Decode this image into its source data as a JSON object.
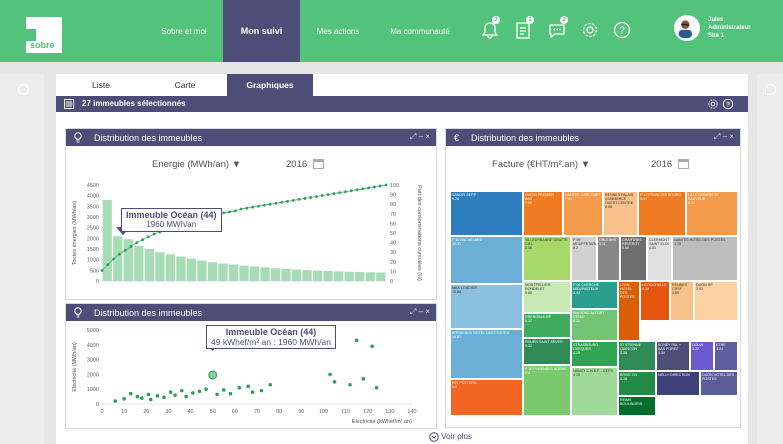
{
  "brand": {
    "logo_text": "sobre",
    "green": "#53c27a",
    "purple": "#4e4d78"
  },
  "nav": [
    {
      "label": "Sobre et moi",
      "active": false
    },
    {
      "label": "Mon suivi",
      "active": true
    },
    {
      "label": "Mes actions",
      "active": false
    },
    {
      "label": "Ma communauté",
      "active": false
    }
  ],
  "notifications": {
    "alerts": "3",
    "reports": "1",
    "messages": "2"
  },
  "user": {
    "name": "Jules",
    "role": "Administrateur",
    "site": "Site 1"
  },
  "tabs": [
    "Liste",
    "Carte",
    "Graphiques"
  ],
  "selection": {
    "label": "27 immeubles  sélectionnés"
  },
  "card1": {
    "title": "Distribution des immeubles",
    "filter": "Energie (MWh/an)",
    "year": "2016"
  },
  "card2": {
    "title": "Distribution des immeubles",
    "filter": "Facture (€HT/m².an)",
    "year": "2016",
    "currency_icon": "€"
  },
  "card3": {
    "title": "Distribution des immeubles"
  },
  "voir_plus": "Voir plus",
  "chart_data": [
    {
      "type": "bar",
      "ylabel": "Toutes énergies (MWh/an)",
      "y2label": "Part des consommations cumulées (%)",
      "ylim": [
        0,
        4500
      ],
      "y2lim": [
        0,
        100
      ],
      "yticks": [
        0,
        500,
        1000,
        1500,
        2000,
        2500,
        3000,
        3500,
        4000,
        4500
      ],
      "y2ticks": [
        0,
        10,
        20,
        30,
        40,
        50,
        60,
        70,
        80,
        90,
        100
      ],
      "values": [
        3800,
        2100,
        1960,
        1650,
        1500,
        1350,
        1250,
        1150,
        1050,
        960,
        880,
        820,
        770,
        720,
        680,
        640,
        600,
        570,
        540,
        510,
        490,
        470,
        450,
        430,
        420,
        410,
        400
      ],
      "cumulative": [
        11,
        17,
        23,
        28,
        32,
        36,
        40,
        43,
        46,
        49,
        51,
        54,
        56,
        58,
        60,
        62,
        64,
        65,
        67,
        68,
        70,
        71,
        72,
        73,
        75,
        76,
        77,
        78,
        79,
        80,
        81,
        82,
        83,
        84,
        85,
        86,
        87,
        88,
        89,
        90,
        91,
        92,
        93,
        94,
        95,
        96,
        97,
        98,
        99,
        100
      ],
      "tooltip": {
        "title": "Immeuble  Océan (44)",
        "value": "1960 MWh/an"
      }
    },
    {
      "type": "treemap",
      "cells": [
        {
          "label": "SANOFI SEPP",
          "value": "9.26",
          "color": "#2f7ec0"
        },
        {
          "label": "OUDIN PREMIER BAS",
          "value": "7.60",
          "color": "#ef7b22"
        },
        {
          "label": "NANTES CARCOUET",
          "value": "7.31",
          "color": "#f39a4b"
        },
        {
          "label": "RENNES PALAIS COMMERCE OUEST-CENTRE",
          "value": "6.08",
          "color": "#f8c08a"
        },
        {
          "label": "P 12 FRANCOIS BOURG",
          "value": "5.94",
          "color": "#ef7b22"
        },
        {
          "label": "LILLE DEMIRIS ST SAUVEUR",
          "value": "5.24",
          "color": "#f39a4b"
        },
        {
          "label": "P 16 BACHELARD",
          "value": "10.31",
          "color": "#6baed6"
        },
        {
          "label": "VILLEURBANNE GRATTE CIEL",
          "value": "5.56",
          "color": "#a6d96a"
        },
        {
          "label": "P 09 MOUFFETARD",
          "value": "5.2",
          "color": "#d0d0d0"
        },
        {
          "label": "ORLEANS",
          "value": "5.11",
          "color": "#888888"
        },
        {
          "label": "CHARTRES REVEROY",
          "value": "5.00",
          "color": "#6f6f6f"
        },
        {
          "label": "CLERMONT SAINT ELOI",
          "value": "4.83",
          "color": "#e0e0e0"
        },
        {
          "label": "NANTES HOTEL DES POSTES",
          "value": "4.78",
          "color": "#bdbdbd"
        },
        {
          "label": "MAX LOUDIER",
          "value": "10.88",
          "color": "#8cc0e0"
        },
        {
          "label": "MONTPELLIER RONDELET",
          "value": "5.88",
          "color": "#c7e9b4"
        },
        {
          "label": "P 06 CHERCHE MIDI/PASTEUR",
          "value": "4.44",
          "color": "#2a9d8f"
        },
        {
          "label": "LYON HOTEL DES POSTES",
          "value": "",
          "color": "#d95f02"
        },
        {
          "label": "LA ROCHELLE",
          "value": "4.05",
          "color": "#e6550d"
        },
        {
          "label": "RENNES CRSF",
          "value": "3.85",
          "color": "#f8c08a"
        },
        {
          "label": "DIJON RP",
          "value": "3.92",
          "color": "#fdd0a2"
        },
        {
          "label": "GRENOBLE RP",
          "value": "5.37",
          "color": "#41ab5d"
        },
        {
          "label": "MAISONS ALFORT STADE",
          "value": "4.21",
          "color": "#74c476"
        },
        {
          "label": "BORDEAUX HOTEL DES POSTES",
          "value": "10.87",
          "color": "#6baed6"
        },
        {
          "label": "ROUEN SAINT SEVER",
          "value": "5.32",
          "color": "#2e8b57"
        },
        {
          "label": "STRASBOURG CHEQUES",
          "value": "4.29",
          "color": "#31a354"
        },
        {
          "label": "ST ETIENNE QUINCON",
          "value": "3.39",
          "color": "#2e8b57"
        },
        {
          "label": "BONEY PAL + BAS FOREZ",
          "value": "3.30",
          "color": "#4e4d78"
        },
        {
          "label": "DOUAI",
          "value": "3.22",
          "color": "#6a5acd"
        },
        {
          "label": "ETRE",
          "value": "3.04",
          "color": "#5e5e9e"
        },
        {
          "label": "P01 POTTERS",
          "value": "9.8",
          "color": "#f26522"
        },
        {
          "label": "P 20 PYRENEES BORNE",
          "value": "5.3",
          "color": "#7bc96f"
        },
        {
          "label": "NANCY C.N.S.F. - CEPS",
          "value": "4.15",
          "color": "#a1d99b"
        },
        {
          "label": "BRIVE CN",
          "value": "3.38",
          "color": "#238b45"
        },
        {
          "label": "NELLY DIRECTION",
          "value": "",
          "color": "#3f3f7a"
        },
        {
          "label": "DIJON HOTEL DES POSTES",
          "value": "",
          "color": "#5c5c99"
        },
        {
          "label": "REIMS BOULINGRIN",
          "value": "",
          "color": "#006d2c"
        }
      ]
    },
    {
      "type": "scatter",
      "xlabel": "Electricité (kWhef/m².an)",
      "ylabel": "Electricité (MWh/an)",
      "xlim": [
        0,
        140
      ],
      "ylim": [
        0,
        5000
      ],
      "xticks": [
        0,
        10,
        20,
        30,
        40,
        50,
        60,
        70,
        80,
        90,
        100,
        110,
        120,
        130,
        140
      ],
      "yticks": [
        0,
        1000,
        2000,
        3000,
        4000,
        5000
      ],
      "points": [
        [
          6,
          200
        ],
        [
          10,
          350
        ],
        [
          13,
          700
        ],
        [
          16,
          500
        ],
        [
          18,
          400
        ],
        [
          21,
          650
        ],
        [
          22,
          300
        ],
        [
          25,
          550
        ],
        [
          28,
          450
        ],
        [
          31,
          800
        ],
        [
          33,
          600
        ],
        [
          36,
          900
        ],
        [
          38,
          500
        ],
        [
          41,
          750
        ],
        [
          44,
          850
        ],
        [
          47,
          1000
        ],
        [
          50,
          1960
        ],
        [
          52,
          650
        ],
        [
          55,
          950
        ],
        [
          58,
          700
        ],
        [
          62,
          1100
        ],
        [
          66,
          1200
        ],
        [
          68,
          800
        ],
        [
          72,
          900
        ],
        [
          76,
          1300
        ],
        [
          103,
          2000
        ],
        [
          105,
          1500
        ],
        [
          112,
          1300
        ],
        [
          115,
          4300
        ],
        [
          118,
          1700
        ],
        [
          122,
          3900
        ],
        [
          124,
          1100
        ]
      ],
      "tooltip": {
        "title": "Immeuble  Océan (44)",
        "value": "49 kWhef/m² an : 1960 MWh/an"
      }
    }
  ]
}
